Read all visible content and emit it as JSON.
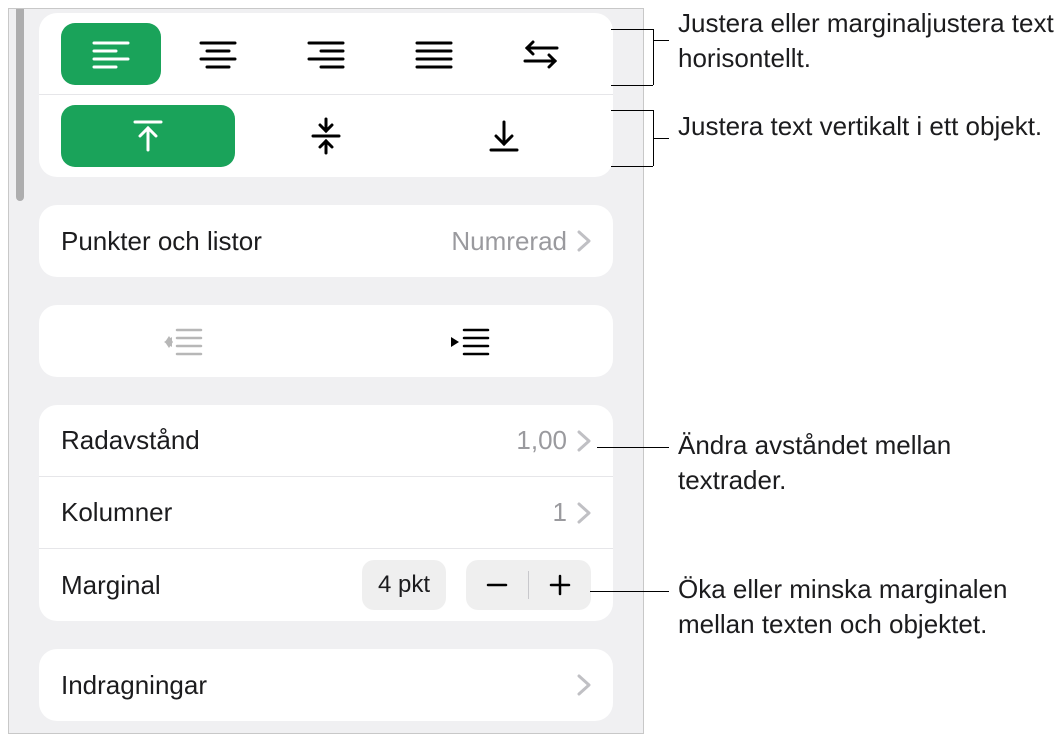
{
  "alignment": {
    "horizontal": {
      "options": [
        "align-left",
        "align-center",
        "align-right",
        "align-justify",
        "direction-swap"
      ],
      "selected": 0
    },
    "vertical": {
      "options": [
        "align-top",
        "align-middle",
        "align-bottom"
      ],
      "selected": 0
    }
  },
  "bullets": {
    "label": "Punkter och listor",
    "value": "Numrerad"
  },
  "indent": {
    "decrease_enabled": false,
    "increase_enabled": true
  },
  "spacing": {
    "line_label": "Radavstånd",
    "line_value": "1,00",
    "columns_label": "Kolumner",
    "columns_value": "1",
    "margin_label": "Marginal",
    "margin_value": "4 pkt",
    "indents_label": "Indragningar"
  },
  "callouts": {
    "h_align": "Justera eller marginaljustera text horisontellt.",
    "v_align": "Justera text vertikalt i ett objekt.",
    "line_spacing": "Ändra avståndet mellan textrader.",
    "margin": "Öka eller minska marginalen mellan texten och objektet."
  }
}
